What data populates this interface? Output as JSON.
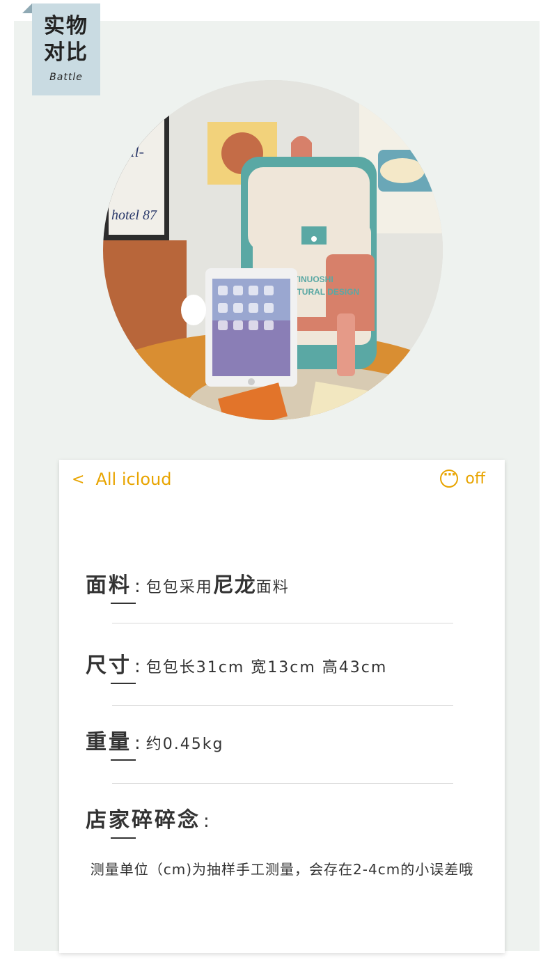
{
  "tag": {
    "title_line1": "实物",
    "title_line2": "对比",
    "subtitle": "Battle"
  },
  "photo": {
    "poster_text": "ITINUOSHI\nNATURAL DESIGN"
  },
  "nav": {
    "back_icon": "<",
    "back_label": "All icloud",
    "more_icon": "ellipsis-circle-icon",
    "right_label": "off"
  },
  "colors": {
    "accent": "#e8a400",
    "panel": "#eef2ef",
    "tag": "#c9dbe2"
  },
  "specs": {
    "material": {
      "label": "面料",
      "colon": ":",
      "value_pre": "包包采用",
      "value_bold": "尼龙",
      "value_post": "面料"
    },
    "size": {
      "label": "尺寸",
      "colon": ":",
      "value": "包包长31cm 宽13cm 高43cm"
    },
    "weight": {
      "label": "重量",
      "colon": ":",
      "value": "约0.45kg"
    },
    "notes": {
      "label": "店家碎碎念",
      "colon": ":"
    }
  },
  "note": "测量单位（cm)为抽样手工测量，会存在2-4cm的小误差哦"
}
